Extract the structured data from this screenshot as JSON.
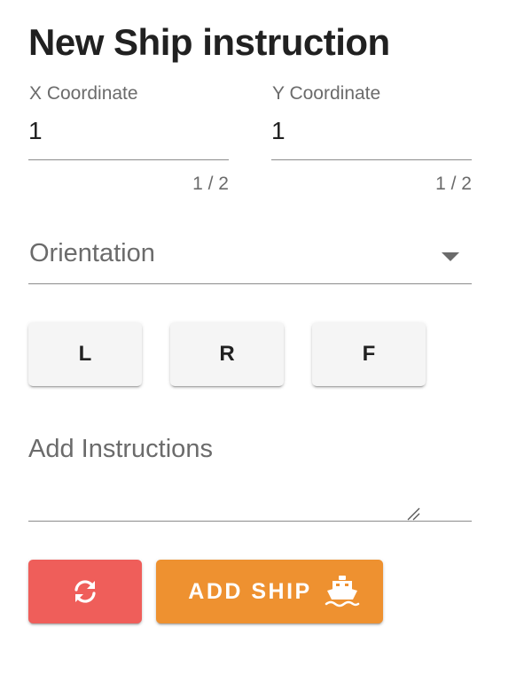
{
  "title": "New Ship instruction",
  "x_coordinate": {
    "label": "X Coordinate",
    "value": "1",
    "counter": "1 / 2"
  },
  "y_coordinate": {
    "label": "Y Coordinate",
    "value": "1",
    "counter": "1 / 2"
  },
  "orientation": {
    "label": "Orientation",
    "icon": "chevron-down-icon"
  },
  "direction_buttons": {
    "left_label": "L",
    "right_label": "R",
    "forward_label": "F"
  },
  "instructions": {
    "placeholder": "Add Instructions",
    "value": ""
  },
  "actions": {
    "reset_icon": "refresh-icon",
    "reset_color": "#ef5e5a",
    "add_label": "ADD SHIP",
    "add_icon": "ship-icon",
    "add_color": "#ee9130"
  }
}
